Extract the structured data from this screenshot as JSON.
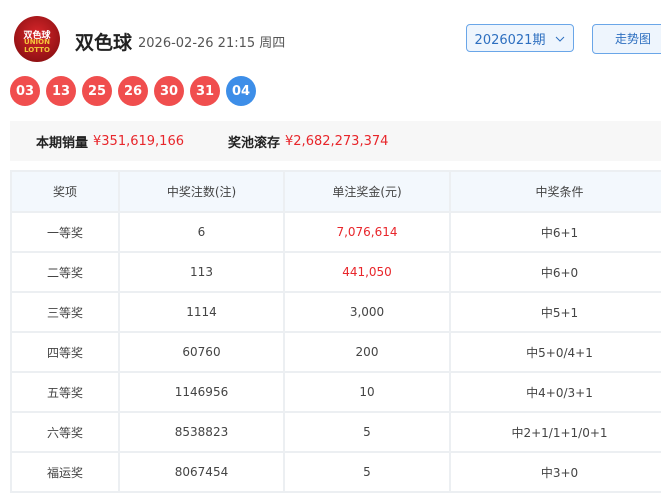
{
  "header": {
    "logo_text": [
      "双色球",
      "UNION",
      "LOTTO"
    ],
    "title": "双色球",
    "datetime": "2026-02-26 21:15 周四",
    "period": "2026021期",
    "trend_button": "走势图"
  },
  "balls": {
    "red": [
      "03",
      "13",
      "25",
      "26",
      "30",
      "31"
    ],
    "blue": [
      "04"
    ],
    "colors": {
      "red": "#f04e4e",
      "blue": "#3d8ee8"
    }
  },
  "info": {
    "sales_label": "本期销量",
    "sales_value": "¥351,619,166",
    "pool_label": "奖池滚存",
    "pool_value": "¥2,682,273,374"
  },
  "table": {
    "headers": [
      "奖项",
      "中奖注数(注)",
      "单注奖金(元)",
      "中奖条件"
    ],
    "rows": [
      [
        "一等奖",
        "6",
        "7,076,614",
        "中6+1"
      ],
      [
        "二等奖",
        "113",
        "441,050",
        "中6+0"
      ],
      [
        "三等奖",
        "1114",
        "3,000",
        "中5+1"
      ],
      [
        "四等奖",
        "60760",
        "200",
        "中5+0/4+1"
      ],
      [
        "五等奖",
        "1146956",
        "10",
        "中4+0/3+1"
      ],
      [
        "六等奖",
        "8538823",
        "5",
        "中2+1/1+1/0+1"
      ],
      [
        "福运奖",
        "8067454",
        "5",
        "中3+0"
      ]
    ],
    "highlight_rows": [
      0,
      1
    ]
  }
}
